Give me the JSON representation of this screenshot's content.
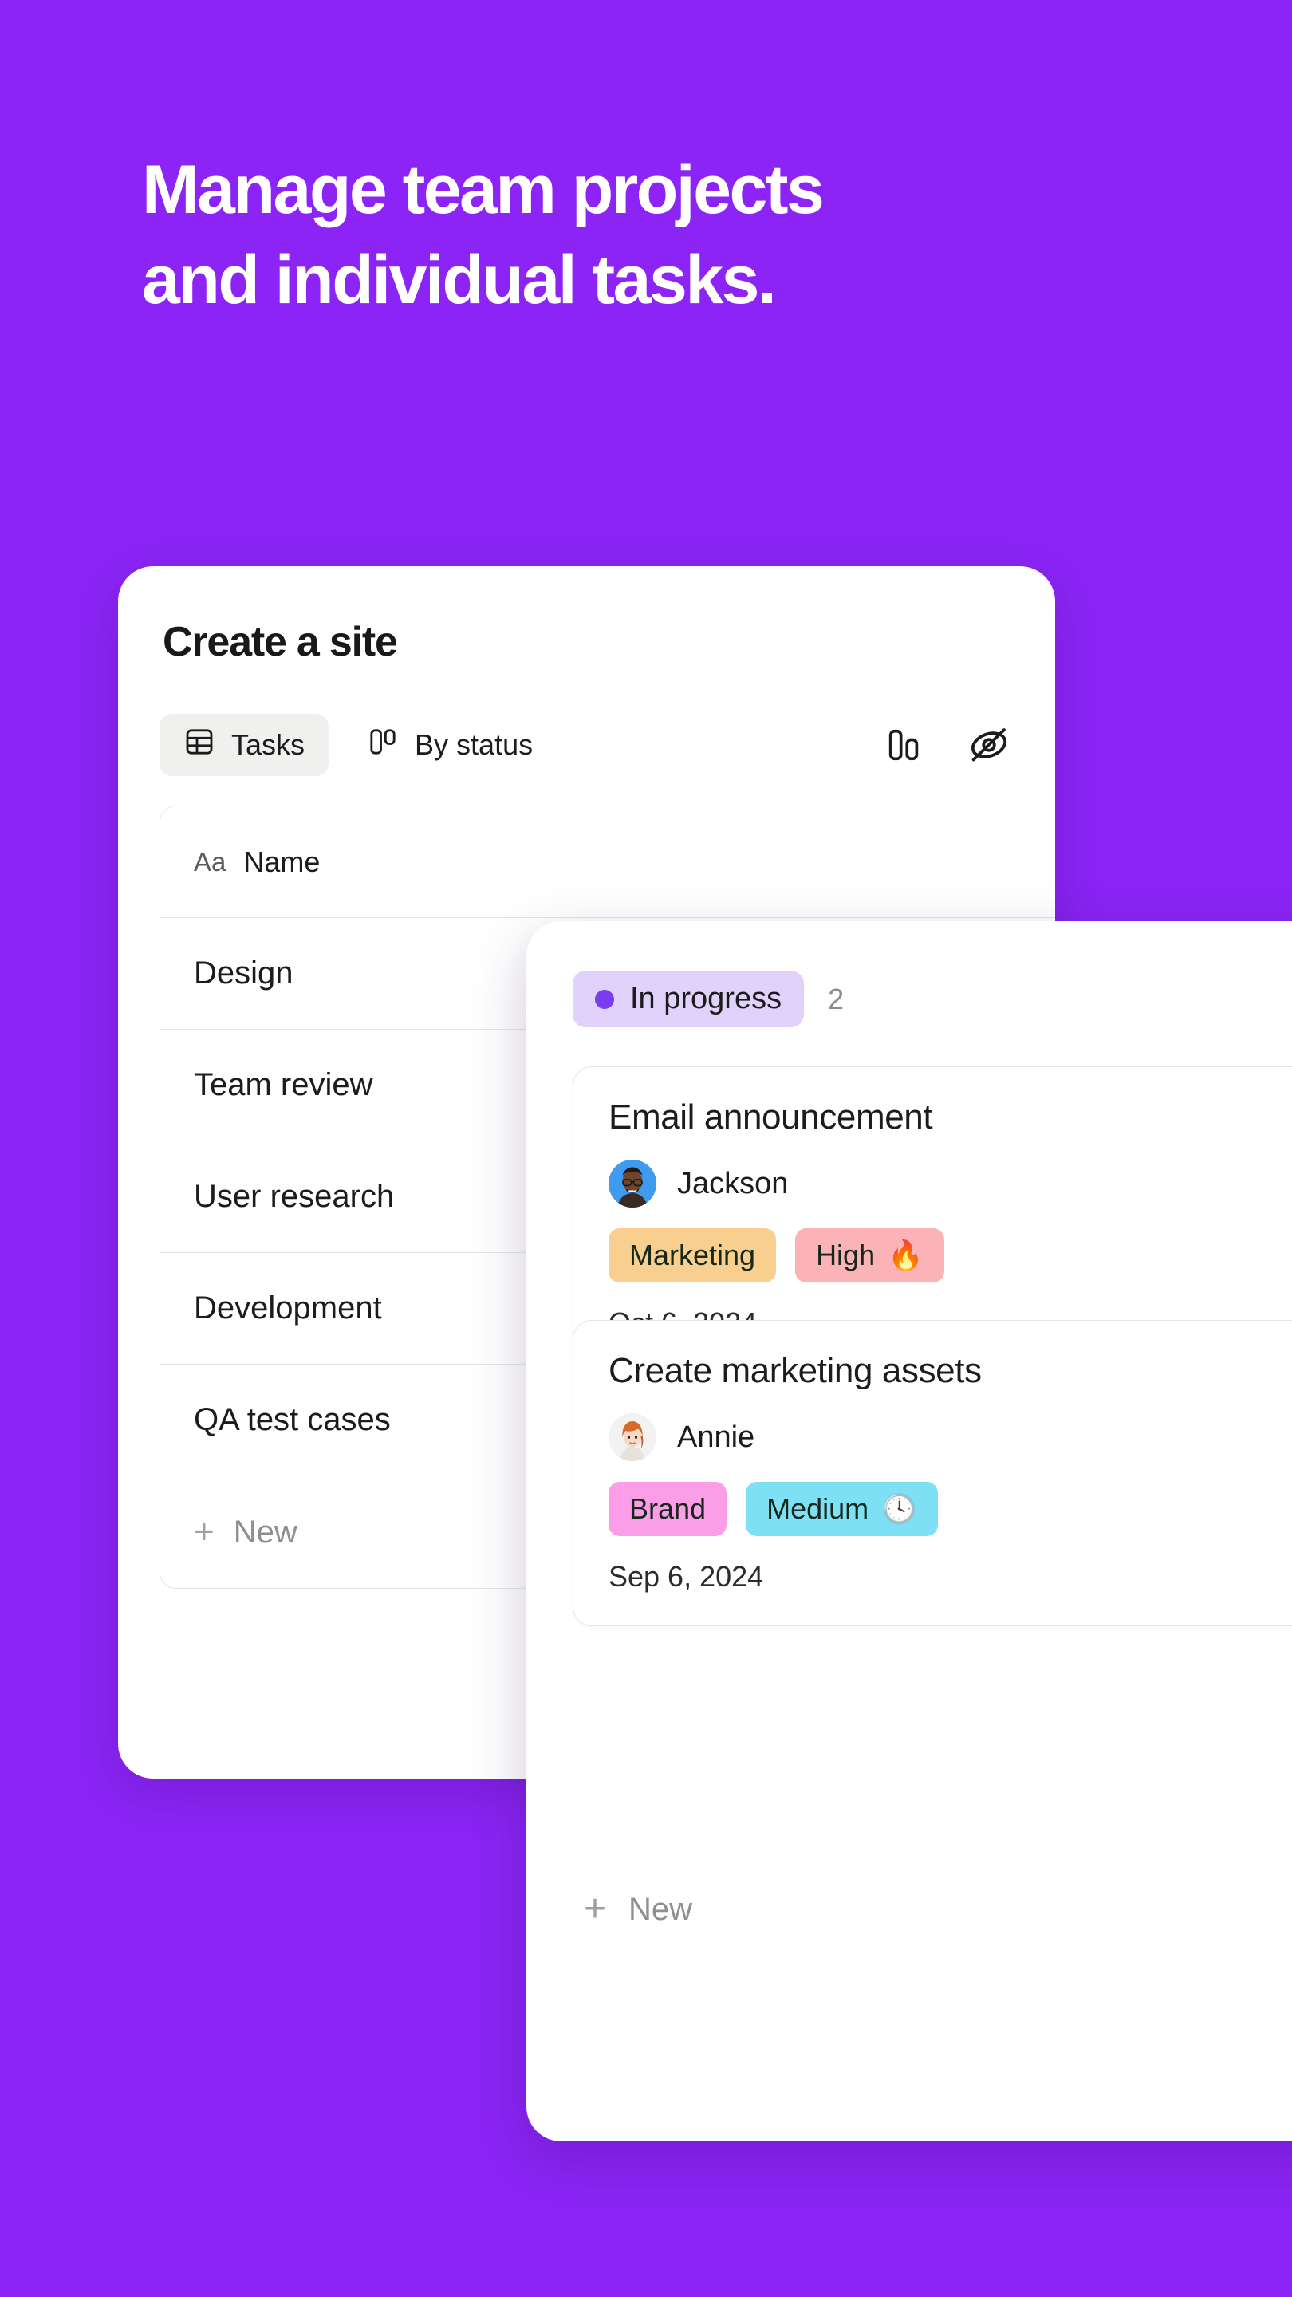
{
  "theme": {
    "background": "#8B24F5",
    "card_background": "#FFFFFF",
    "accent_purple": "#7B3BEE",
    "status_pill_bg": "#E1D2FB"
  },
  "hero": {
    "line1": "Manage team projects",
    "line2": "and individual tasks."
  },
  "table_card": {
    "title": "Create a site",
    "toolbar": {
      "tabs": [
        {
          "label": "Tasks",
          "icon": "table-icon",
          "active": true
        },
        {
          "label": "By status",
          "icon": "board-icon",
          "active": false
        }
      ],
      "actions": [
        {
          "name": "group-by-icon",
          "label": "Group"
        },
        {
          "name": "hide-fields-icon",
          "label": "Hide fields"
        }
      ]
    },
    "columns": [
      {
        "icon": "aa-text-icon",
        "label": "Name"
      }
    ],
    "rows": [
      {
        "name": "Design"
      },
      {
        "name": "Team review"
      },
      {
        "name": "User research"
      },
      {
        "name": "Development"
      },
      {
        "name": "QA test cases"
      }
    ],
    "new_row_label": "New"
  },
  "board_card": {
    "group": {
      "status_label": "In progress",
      "count": "2",
      "dot_color": "#7B3BEE",
      "pill_color": "#E1D2FB"
    },
    "tasks": [
      {
        "title": "Email announcement",
        "assignee": "Jackson",
        "avatar": "jackson-avatar",
        "tags": [
          {
            "label": "Marketing",
            "color": "#F9CF90",
            "emoji": ""
          },
          {
            "label": "High",
            "color": "#FBB3B7",
            "emoji": "🔥"
          }
        ],
        "date": "Oct 6, 2024"
      },
      {
        "title": "Create marketing assets",
        "assignee": "Annie",
        "avatar": "annie-avatar",
        "tags": [
          {
            "label": "Brand",
            "color": "#FB9DE7",
            "emoji": ""
          },
          {
            "label": "Medium",
            "color": "#7DE0F5",
            "emoji": "🕓"
          }
        ],
        "date": "Sep 6, 2024"
      }
    ],
    "new_card_label": "New"
  }
}
